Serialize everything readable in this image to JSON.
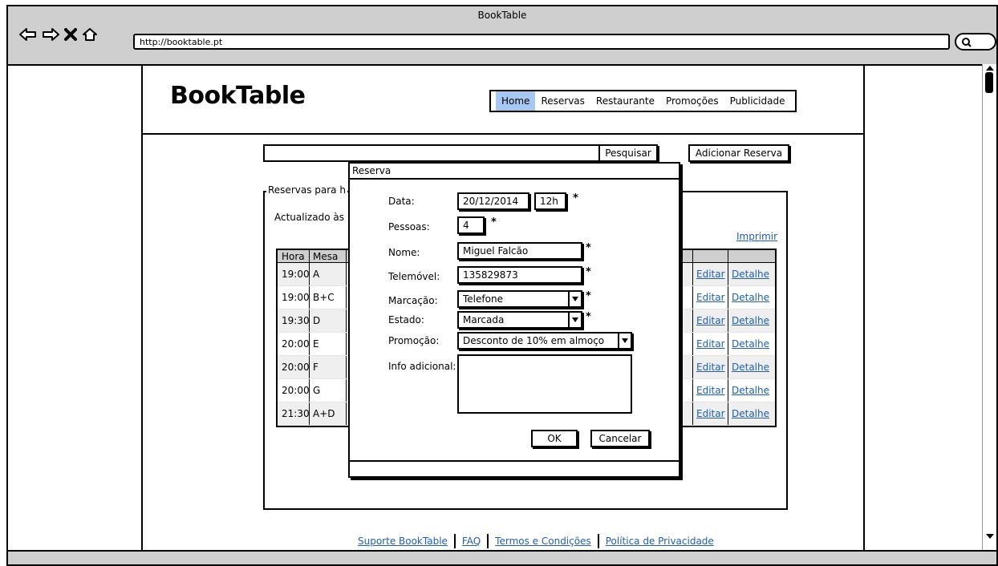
{
  "browser": {
    "title": "BookTable",
    "url": "http://booktable.pt"
  },
  "site": {
    "logo": "BookTable",
    "menu": [
      "Home",
      "Reservas",
      "Restaurante",
      "Promoções",
      "Publicidade"
    ],
    "active_menu": "Home"
  },
  "search": {
    "button": "Pesquisar",
    "add_button": "Adicionar Reserva"
  },
  "reservations": {
    "legend": "Reservas para h",
    "updated": "Actualizado às 1",
    "print": "Imprimir",
    "headers": {
      "hora": "Hora",
      "mesa": "Mesa"
    },
    "rows": [
      {
        "hora": "19:00",
        "mesa": "A",
        "edit": "Editar",
        "detail": "Detalhe"
      },
      {
        "hora": "19:00",
        "mesa": "B+C",
        "edit": "Editar",
        "detail": "Detalhe"
      },
      {
        "hora": "19:30",
        "mesa": "D",
        "edit": "Editar",
        "detail": "Detalhe"
      },
      {
        "hora": "20:00",
        "mesa": "E",
        "edit": "Editar",
        "detail": "Detalhe"
      },
      {
        "hora": "20:00",
        "mesa": "F",
        "edit": "Editar",
        "detail": "Detalhe"
      },
      {
        "hora": "20:00",
        "mesa": "G",
        "edit": "Editar",
        "detail": "Detalhe"
      },
      {
        "hora": "21:30",
        "mesa": "A+D",
        "edit": "Editar",
        "detail": "Detalhe"
      }
    ]
  },
  "footer": {
    "links": [
      "Suporte BookTable",
      "FAQ",
      "Termos e Condições",
      "Política de Privacidade"
    ]
  },
  "modal": {
    "title": "Reserva",
    "labels": {
      "data": "Data:",
      "pessoas": "Pessoas:",
      "nome": "Nome:",
      "telemovel": "Telemóvel:",
      "marcacao": "Marcação:",
      "estado": "Estado:",
      "promocao": "Promoção:",
      "info": "Info adicional:"
    },
    "values": {
      "data": "20/12/2014",
      "hora": "12h",
      "pessoas": "4",
      "nome": "Miguel Falcão",
      "telemovel": "135829873",
      "marcacao": "Telefone",
      "estado": "Marcada",
      "promocao": "Desconto de 10% em almoço",
      "info": ""
    },
    "required_mark": "*",
    "ok": "OK",
    "cancel": "Cancelar"
  },
  "colors": {
    "active_menu_bg": "#a8c8f4",
    "link": "#1f5fb5",
    "chrome": "#cfcfcf"
  }
}
